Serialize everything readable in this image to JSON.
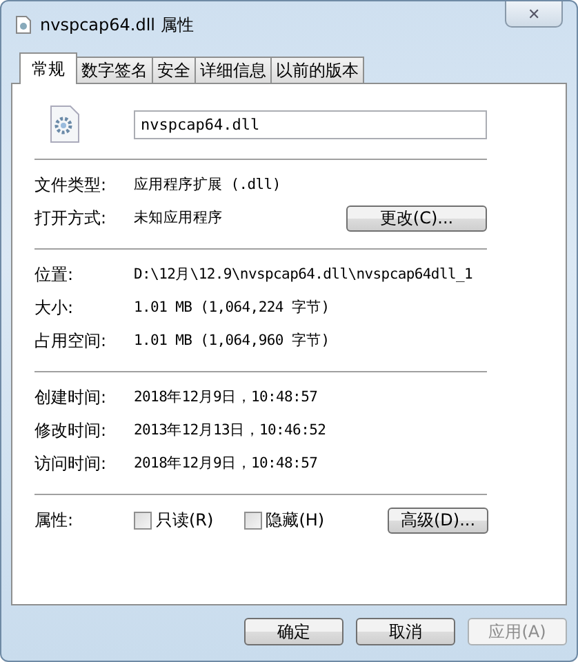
{
  "window": {
    "title": "nvspcap64.dll 属性",
    "close": "✕"
  },
  "tabs": [
    {
      "label": "常规",
      "selected": true
    },
    {
      "label": "数字签名",
      "selected": false
    },
    {
      "label": "安全",
      "selected": false
    },
    {
      "label": "详细信息",
      "selected": false
    },
    {
      "label": "以前的版本",
      "selected": false
    }
  ],
  "file_name": "nvspcap64.dll",
  "groups": [
    [
      {
        "label": "文件类型:",
        "value": "应用程序扩展 (.dll)"
      },
      {
        "label": "打开方式:",
        "value": "未知应用程序",
        "button": "更改(C)..."
      }
    ],
    [
      {
        "label": "位置:",
        "value": "D:\\12月\\12.9\\nvspcap64.dll\\nvspcap64dll_1"
      },
      {
        "label": "大小:",
        "value": "1.01 MB (1,064,224 字节)"
      },
      {
        "label": "占用空间:",
        "value": "1.01 MB (1,064,960 字节)"
      }
    ],
    [
      {
        "label": "创建时间:",
        "value": "2018年12月9日，10:48:57"
      },
      {
        "label": "修改时间:",
        "value": "2013年12月13日，10:46:52"
      },
      {
        "label": "访问时间:",
        "value": "2018年12月9日，10:48:57"
      }
    ]
  ],
  "attributes": {
    "label": "属性:",
    "options": [
      {
        "label": "只读(R)",
        "checked": false
      },
      {
        "label": "隐藏(H)",
        "checked": false
      }
    ],
    "button": "高级(D)..."
  },
  "buttons": [
    {
      "label": "确定",
      "disabled": false
    },
    {
      "label": "取消",
      "disabled": false
    },
    {
      "label": "应用(A)",
      "disabled": true
    }
  ]
}
